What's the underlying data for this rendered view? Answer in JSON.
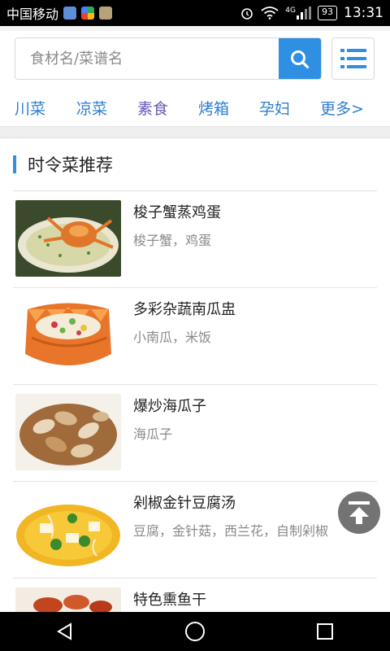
{
  "status_bar": {
    "carrier": "中国移动",
    "network": "4G",
    "battery": "93",
    "time": "13:31"
  },
  "search": {
    "placeholder": "食材名/菜谱名"
  },
  "categories": [
    "川菜",
    "凉菜",
    "素食",
    "烤箱",
    "孕妇",
    "更多>"
  ],
  "section": {
    "title": "时令菜推荐"
  },
  "recipes": [
    {
      "title": "梭子蟹蒸鸡蛋",
      "ingredients": "梭子蟹，鸡蛋"
    },
    {
      "title": "多彩杂蔬南瓜盅",
      "ingredients": "小南瓜，米饭"
    },
    {
      "title": "爆炒海瓜子",
      "ingredients": "海瓜子"
    },
    {
      "title": "剁椒金针豆腐汤",
      "ingredients": "豆腐，金针菇，西兰花，自制剁椒"
    },
    {
      "title": "特色熏鱼干",
      "ingredients": ""
    }
  ],
  "colors": {
    "accent": "#2f8fe3",
    "category": "#2f7fd0"
  },
  "icons": {
    "search": "search-icon",
    "menu": "list-icon",
    "back_to_top": "arrow-up-to-top-icon"
  }
}
